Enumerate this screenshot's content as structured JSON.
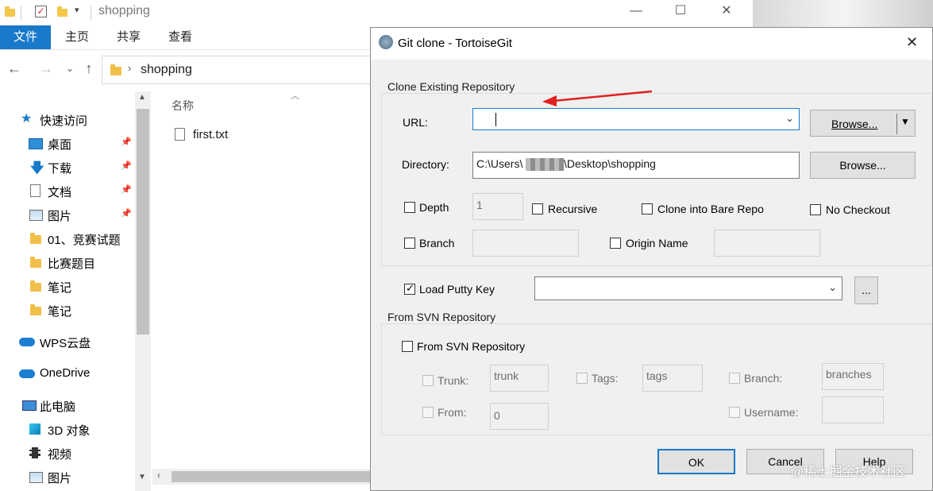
{
  "explorer": {
    "title": "shopping",
    "ribbon_tabs": [
      "文件",
      "主页",
      "共享",
      "查看"
    ],
    "address_path": "shopping",
    "column_name": "名称",
    "file_name": "first.txt",
    "nav_items": [
      {
        "label": "快速访问",
        "icon": "star-icon"
      },
      {
        "label": "桌面",
        "icon": "desktop-icon"
      },
      {
        "label": "下载",
        "icon": "download-icon"
      },
      {
        "label": "文档",
        "icon": "document-icon"
      },
      {
        "label": "图片",
        "icon": "picture-icon"
      },
      {
        "label": "01、竞赛试题",
        "icon": "folder-icon"
      },
      {
        "label": "比赛题目",
        "icon": "folder-icon"
      },
      {
        "label": "笔记",
        "icon": "folder-icon"
      },
      {
        "label": "笔记",
        "icon": "folder-icon"
      },
      {
        "label": "WPS云盘",
        "icon": "cloud-icon"
      },
      {
        "label": "OneDrive",
        "icon": "cloud-icon"
      },
      {
        "label": "此电脑",
        "icon": "computer-icon"
      },
      {
        "label": "3D 对象",
        "icon": "cube-icon"
      },
      {
        "label": "视频",
        "icon": "video-icon"
      },
      {
        "label": "图片",
        "icon": "picture-icon"
      }
    ]
  },
  "dialog": {
    "title": "Git clone - TortoiseGit",
    "group_clone": "Clone Existing Repository",
    "url_label": "URL:",
    "url_value": "",
    "browse_url": "Browse...",
    "directory_label": "Directory:",
    "directory_value": "C:\\Users\\",
    "directory_value_tail": "\\Desktop\\shopping",
    "browse_dir": "Browse...",
    "depth_label": "Depth",
    "depth_value": "1",
    "recursive_label": "Recursive",
    "bare_label": "Clone into Bare Repo",
    "nocheckout_label": "No Checkout",
    "branch_label": "Branch",
    "origin_label": "Origin Name",
    "putty_label": "Load Putty Key",
    "putty_browse": "...",
    "group_svn": "From SVN Repository",
    "svn_label": "From SVN Repository",
    "trunk_label": "Trunk:",
    "trunk_value": "trunk",
    "tags_label": "Tags:",
    "tags_value": "tags",
    "svn_branch_label": "Branch:",
    "branches_value": "branches",
    "from_label": "From:",
    "from_value": "0",
    "username_label": "Username:",
    "ok": "OK",
    "cancel": "Cancel",
    "help": "Help"
  },
  "watermark": "@稀土掘金技术社区",
  "colors": {
    "accent": "#1979ca",
    "arrow": "#e02020",
    "dialog_bg": "#f0f0f0"
  }
}
